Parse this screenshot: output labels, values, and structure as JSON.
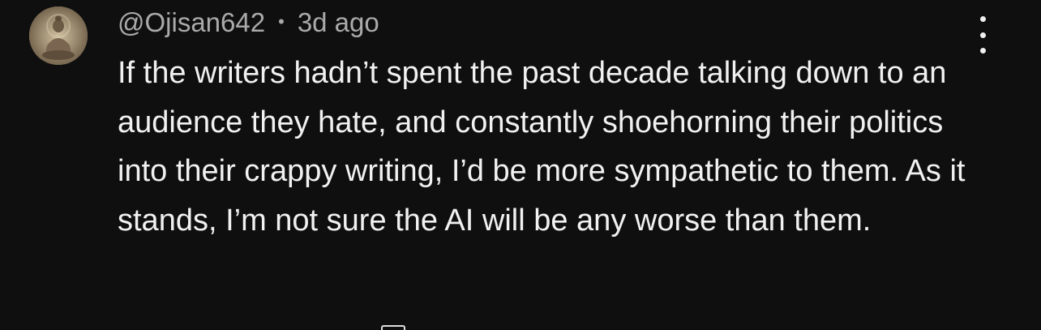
{
  "comment": {
    "username": "@Ojisan642",
    "separator": "•",
    "timestamp": "3d ago",
    "text": "If the writers hadn’t spent the past decade talking down to an audience they hate, and constantly shoehorning their politics into their crappy writing, I’d be more sympathetic to them. As it stands, I’m not sure the AI will be any worse than them.",
    "avatar_icon": "avatar-buddha-statue-image",
    "menu_icon": "more-vertical-icon"
  },
  "colors": {
    "background": "#0f0f0f",
    "text_primary": "#f1f1f1",
    "text_secondary": "#aaaaaa"
  }
}
